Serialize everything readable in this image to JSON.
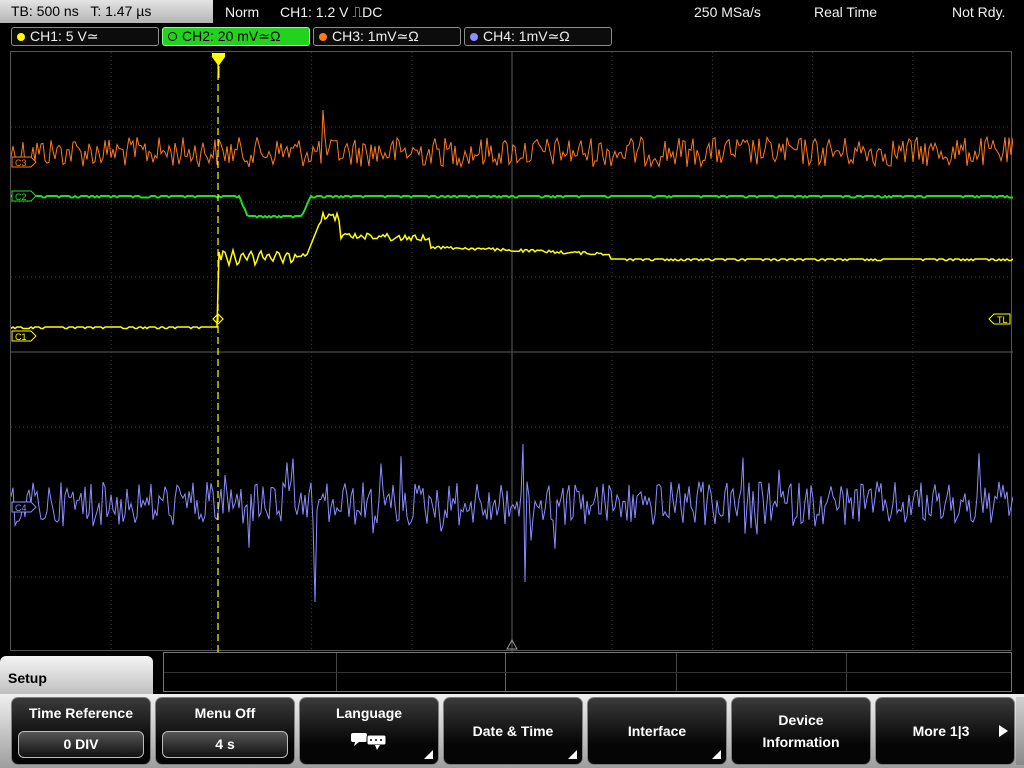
{
  "header": {
    "timebase": "TB: 500 ns",
    "trigger_time": "T: 1.47 µs",
    "mode": "Norm",
    "trigger_source": "CH1: 1.2 V ⎍DC",
    "sample_rate": "250 MSa/s",
    "acq_mode": "Real Time",
    "status": "Not Rdy."
  },
  "channels": [
    {
      "label": "CH1: 5 V≃",
      "color": "#ffff00"
    },
    {
      "label": "CH2: 20 mV≃Ω",
      "color": "#22dd22"
    },
    {
      "label": "CH3: 1mV≃Ω",
      "color": "#ff7a1e"
    },
    {
      "label": "CH4: 1mV≃Ω",
      "color": "#8c8cff"
    }
  ],
  "markers": {
    "ch3": "C3",
    "ch2": "C2",
    "ch1": "C1",
    "ch4": "C4",
    "trigger_level": "TL"
  },
  "menu": {
    "title": "Setup",
    "softkeys": [
      {
        "label": "Time Reference",
        "value": "0 DIV"
      },
      {
        "label": "Menu Off",
        "value": "4 s"
      },
      {
        "label": "Language",
        "icon": "speech-bubble-icon"
      },
      {
        "label": "Date & Time"
      },
      {
        "label": "Interface"
      },
      {
        "label": "Device",
        "label2": "Information"
      },
      {
        "label": "More 1|3"
      }
    ]
  }
}
